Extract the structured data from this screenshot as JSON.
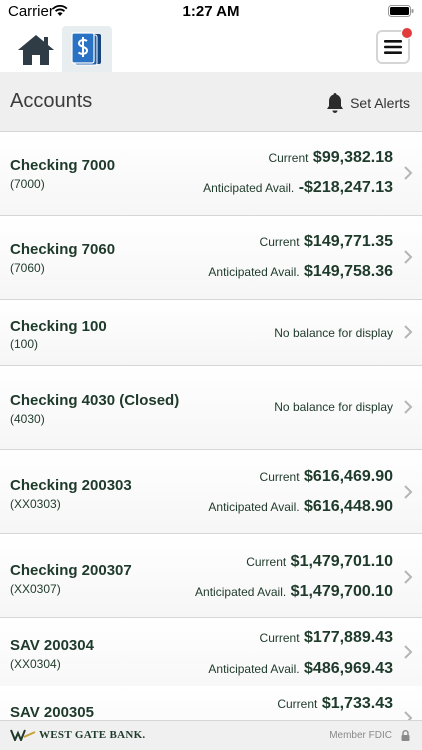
{
  "status_bar": {
    "carrier": "Carrier",
    "time": "1:27 AM"
  },
  "nav": {
    "icons": [
      "home-icon",
      "accounts-icon",
      "hamburger-menu-icon"
    ],
    "accent": "#1f5fa8",
    "notify_color": "#e23b3b"
  },
  "header": {
    "title": "Accounts",
    "set_alerts_label": "Set Alerts"
  },
  "accounts": [
    {
      "name": "Checking 7000",
      "number": "(7000)",
      "current_label": "Current",
      "current": "$99,382.18",
      "anticipated_label": "Anticipated Avail.",
      "anticipated": "-$218,247.13"
    },
    {
      "name": "Checking 7060",
      "number": "(7060)",
      "current_label": "Current",
      "current": "$149,771.35",
      "anticipated_label": "Anticipated Avail.",
      "anticipated": "$149,758.36"
    },
    {
      "name": "Checking 100",
      "number": "(100)",
      "no_balance": "No balance for display"
    },
    {
      "name": "Checking 4030 (Closed)",
      "number": "(4030)",
      "no_balance": "No balance for display"
    },
    {
      "name": "Checking 200303",
      "number": "(XX0303)",
      "current_label": "Current",
      "current": "$616,469.90",
      "anticipated_label": "Anticipated Avail.",
      "anticipated": "$616,448.90"
    },
    {
      "name": "Checking 200307",
      "number": "(XX0307)",
      "current_label": "Current",
      "current": "$1,479,701.10",
      "anticipated_label": "Anticipated Avail.",
      "anticipated": "$1,479,700.10"
    },
    {
      "name": "SAV 200304",
      "number": "(XX0304)",
      "current_label": "Current",
      "current": "$177,889.43",
      "anticipated_label": "Anticipated Avail.",
      "anticipated": "$486,969.43"
    },
    {
      "name": "SAV 200305",
      "number": "",
      "current_label": "Current",
      "current": "$1,733.43"
    }
  ],
  "footer": {
    "bank_name": "WEST GATE BANK.",
    "member_fdic": "Member FDIC"
  }
}
